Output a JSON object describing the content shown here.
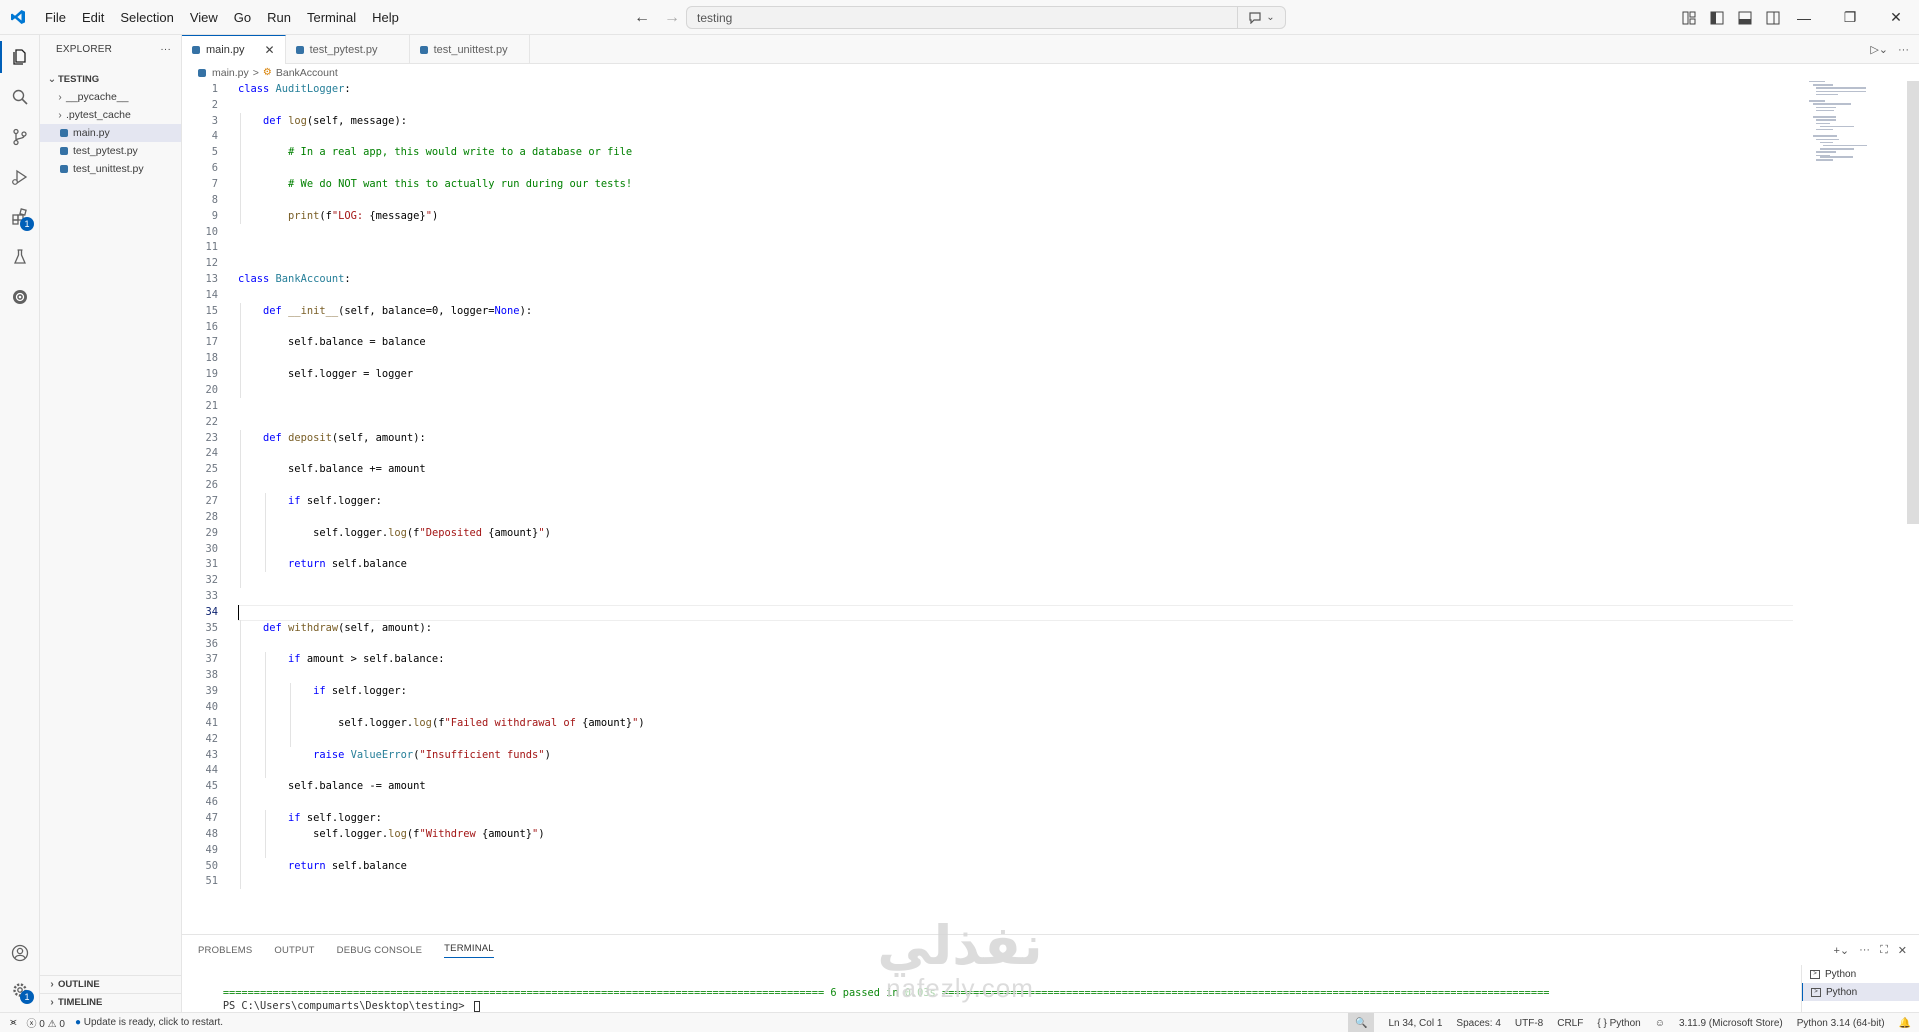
{
  "menu": [
    "File",
    "Edit",
    "Selection",
    "View",
    "Go",
    "Run",
    "Terminal",
    "Help"
  ],
  "search": {
    "value": "testing"
  },
  "explorer": {
    "title": "EXPLORER",
    "more": "···",
    "folder": "TESTING",
    "items": [
      {
        "label": "__pycache__",
        "type": "folder"
      },
      {
        "label": ".pytest_cache",
        "type": "folder"
      },
      {
        "label": "main.py",
        "type": "file"
      },
      {
        "label": "test_pytest.py",
        "type": "file"
      },
      {
        "label": "test_unittest.py",
        "type": "file"
      }
    ],
    "outline": "OUTLINE",
    "timeline": "TIMELINE"
  },
  "tabs": [
    {
      "label": "main.py",
      "close": "✕"
    },
    {
      "label": "test_pytest.py"
    },
    {
      "label": "test_unittest.py"
    }
  ],
  "breadcrumb": {
    "file": "main.py",
    "separator": ">",
    "symbol": "BankAccount"
  },
  "activity": {
    "extensions_badge": "1",
    "settings_badge": "1"
  },
  "code": [
    "class AuditLogger:",
    "",
    "    def log(self, message):",
    "",
    "        # In a real app, this would write to a database or file",
    "",
    "        # We do NOT want this to actually run during our tests!",
    "",
    "        print(f\"LOG: {message}\")",
    "",
    "",
    "",
    "class BankAccount:",
    "",
    "    def __init__(self, balance=0, logger=None):",
    "",
    "        self.balance = balance",
    "",
    "        self.logger = logger",
    "",
    "",
    "",
    "    def deposit(self, amount):",
    "",
    "        self.balance += amount",
    "",
    "        if self.logger:",
    "",
    "            self.logger.log(f\"Deposited {amount}\")",
    "",
    "        return self.balance",
    "",
    "",
    "",
    "    def withdraw(self, amount):",
    "",
    "        if amount > self.balance:",
    "",
    "            if self.logger:",
    "",
    "                self.logger.log(f\"Failed withdrawal of {amount}\")",
    "",
    "            raise ValueError(\"Insufficient funds\")",
    "",
    "        self.balance -= amount",
    "",
    "        if self.logger:",
    "            self.logger.log(f\"Withdrew {amount}\")",
    "",
    "        return self.balance",
    ""
  ],
  "current_line": 34,
  "panel": {
    "tabs": [
      "PROBLEMS",
      "OUTPUT",
      "DEBUG CONSOLE",
      "TERMINAL"
    ],
    "active": "TERMINAL",
    "terminal_lines": [
      {
        "rule_left": "=================================================================================================",
        "pass_text": "6 passed in ",
        "time": "0.03s",
        "rule_right": "=================================================================================================="
      },
      {
        "prompt": "PS C:\\Users\\compumarts\\Desktop\\testing> "
      }
    ],
    "terminals": [
      "Python",
      "Python"
    ]
  },
  "watermark": {
    "arabic": "نفذلي",
    "latin": "nafezly.com"
  },
  "status": {
    "errors": "0",
    "warnings": "0",
    "update": "Update is ready, click to restart.",
    "position": "Ln 34, Col 1",
    "spaces": "Spaces: 4",
    "encoding": "UTF-8",
    "eol": "CRLF",
    "braces": "{ }",
    "language": "Python",
    "interpreter": "3.11.9 (Microsoft Store)",
    "python_version": "Python 3.14 (64-bit)"
  },
  "colors": {
    "accent": "#005fb8",
    "keyword": "#0000ff",
    "class": "#267f99",
    "string": "#a31515",
    "comment": "#008000"
  }
}
